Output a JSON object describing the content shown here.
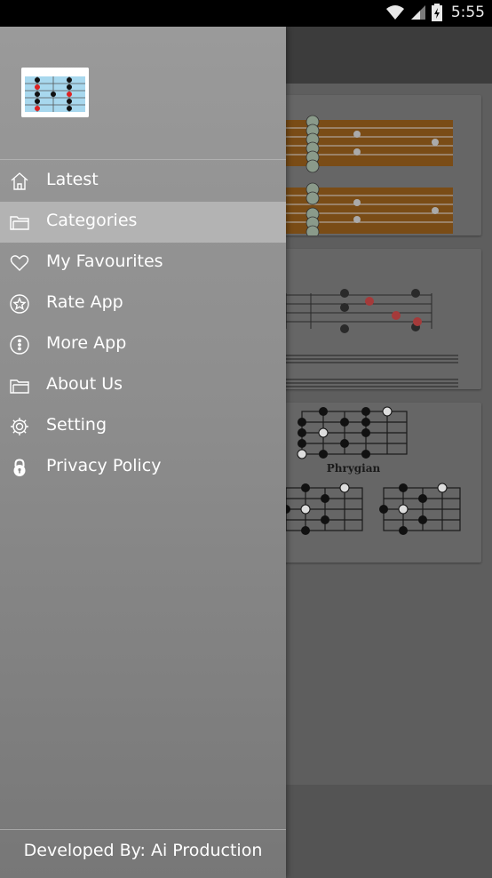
{
  "status": {
    "time": "5:55"
  },
  "menu": {
    "items": [
      {
        "label": "Latest",
        "icon": "home-icon"
      },
      {
        "label": "Categories",
        "icon": "folder-icon",
        "active": true
      },
      {
        "label": "My Favourites",
        "icon": "heart-icon"
      },
      {
        "label": "Rate App",
        "icon": "star-icon"
      },
      {
        "label": "More App",
        "icon": "more-icon"
      },
      {
        "label": "About Us",
        "icon": "folder-icon"
      },
      {
        "label": "Setting",
        "icon": "gear-icon"
      },
      {
        "label": "Privacy Policy",
        "icon": "lock-icon"
      }
    ]
  },
  "footer": {
    "text": "Developed By: Ai Production"
  },
  "background": {
    "card3_caption": "Phrygian"
  },
  "colors": {
    "drawer_top": "#9a9a9a",
    "drawer_bottom": "#777777",
    "active_item": "#b3b3b3"
  }
}
